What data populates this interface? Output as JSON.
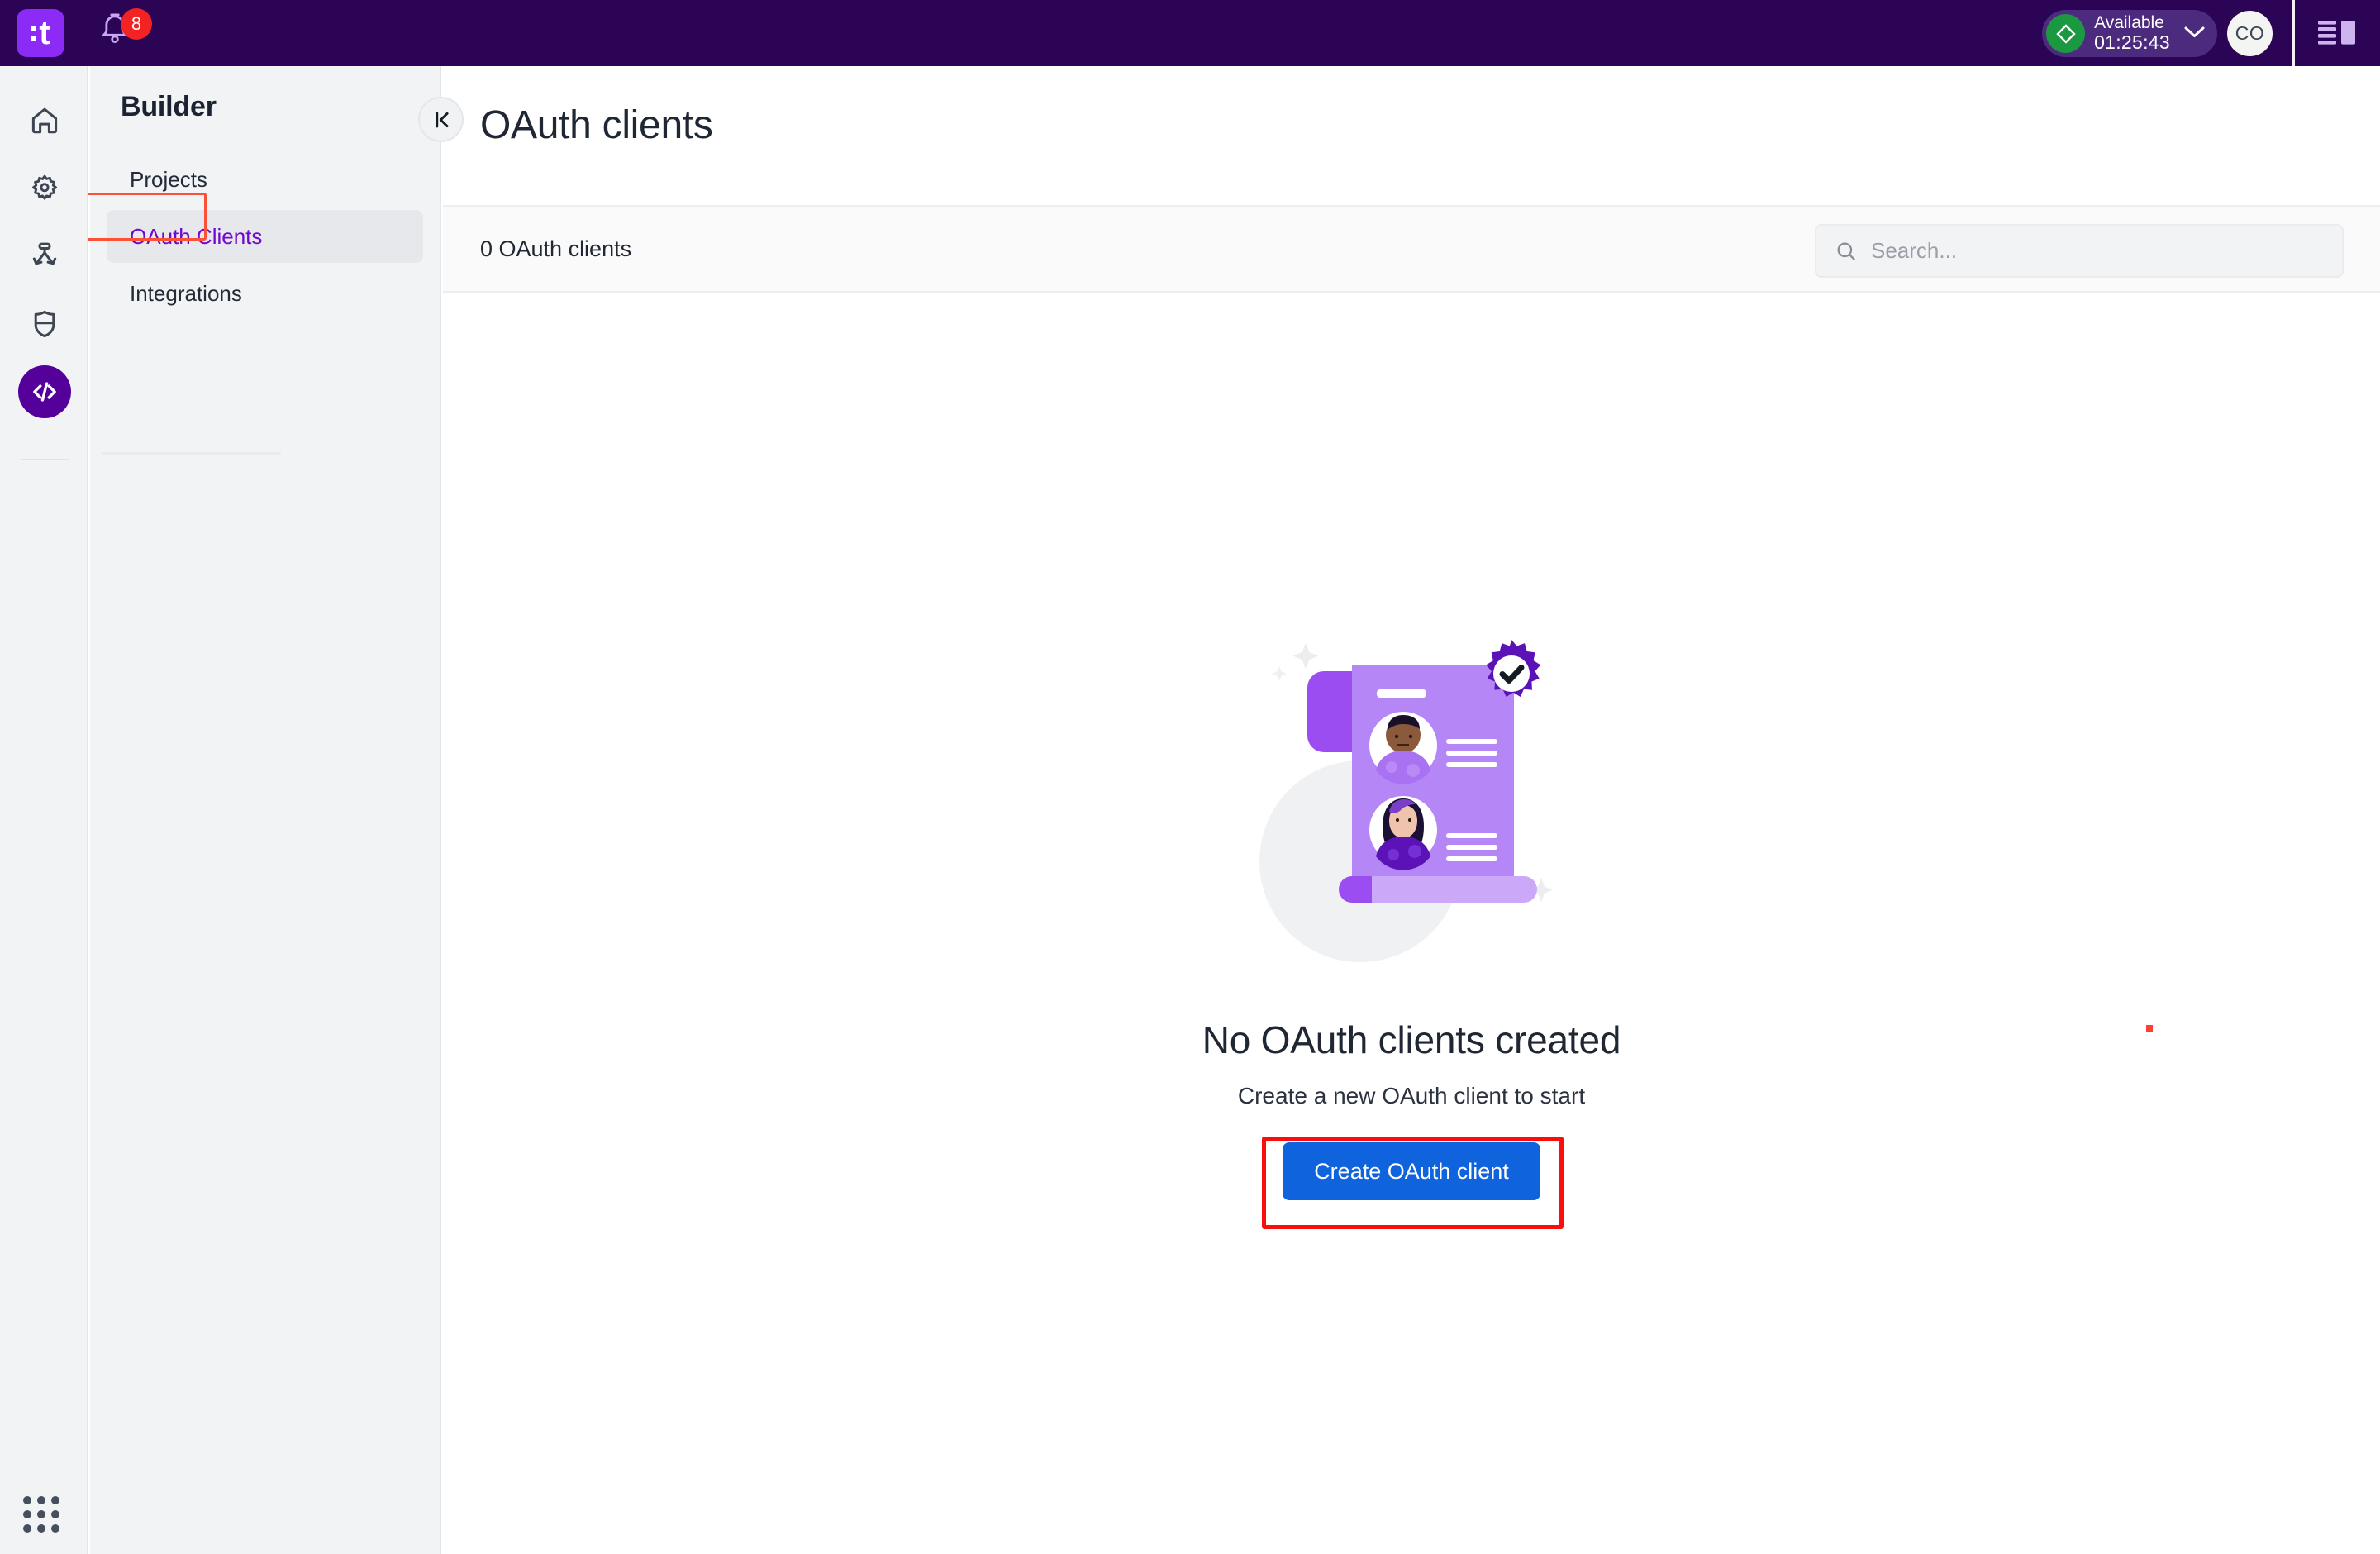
{
  "header": {
    "logo_icon": "tines-logo-icon",
    "notifications": {
      "icon": "bell-icon",
      "badge_count": "8"
    },
    "status": {
      "icon": "diamond-available-icon",
      "label": "Available",
      "timer": "01:25:43",
      "chevron_icon": "chevron-down-icon"
    },
    "avatar_initials": "CO",
    "panel_toggle_icon": "right-panel-icon",
    "bg_color": "#2B0455",
    "badge_color": "#F42323",
    "status_green": "#1A9940"
  },
  "rail": {
    "items": [
      {
        "icon": "home-icon",
        "active": false
      },
      {
        "icon": "gear-icon",
        "active": false
      },
      {
        "icon": "workflow-branch-icon",
        "active": false
      },
      {
        "icon": "shield-icon",
        "active": false
      },
      {
        "icon": "code-brackets-icon",
        "active": true
      }
    ],
    "apps_icon": "apps-grid-icon",
    "active_color": "#55009B"
  },
  "sidebar": {
    "title": "Builder",
    "items": [
      {
        "label": "Projects",
        "selected": false
      },
      {
        "label": "OAuth Clients",
        "selected": true
      },
      {
        "label": "Integrations",
        "selected": false
      }
    ],
    "selected_text_color": "#6F08D0",
    "selected_bg_color": "#E6E8EB",
    "collapse_icon": "collapse-panel-icon"
  },
  "main": {
    "page_title": "OAuth clients",
    "toolbar": {
      "count_label": "0 OAuth clients",
      "search": {
        "icon": "search-icon",
        "placeholder": "Search...",
        "value": ""
      }
    },
    "empty_state": {
      "illustration": "oauth-clients-empty-illustration",
      "title": "No OAuth clients created",
      "subtitle": "Create a new OAuth client to start",
      "cta_label": "Create OAuth client",
      "cta_color": "#0F63DD"
    }
  },
  "annotations": {
    "nav_highlight_color": "#FB5138",
    "cta_highlight_color": "#FC0D0D",
    "cursor_marker_color": "#FC4034"
  }
}
